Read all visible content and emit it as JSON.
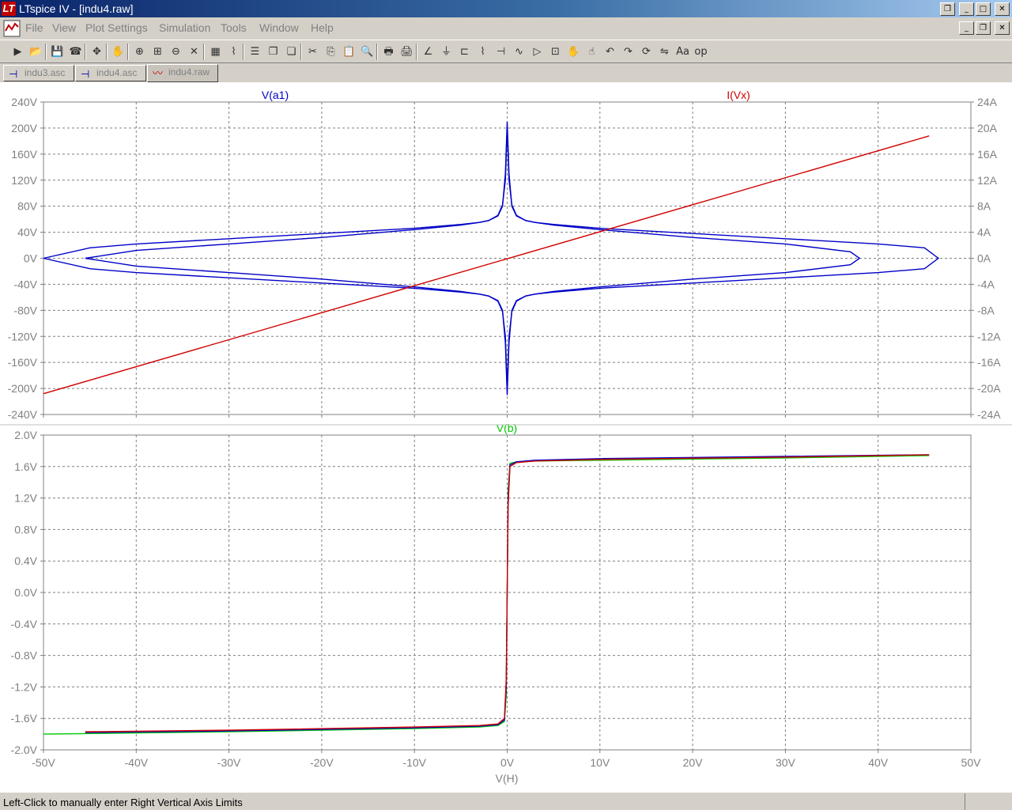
{
  "window": {
    "title": "LTspice IV - [indu4.raw]"
  },
  "menu": [
    "File",
    "View",
    "Plot Settings",
    "Simulation",
    "Tools",
    "Window",
    "Help"
  ],
  "toolbar_icons": [
    "run-icon",
    "open-icon",
    "save-icon",
    "control-panel-icon",
    "autorange-icon",
    "pan-icon",
    "zoom-in-icon",
    "zoom-area-icon",
    "zoom-out-icon",
    "cancel-icon",
    "grid-icon",
    "marker-icon",
    "tile-horizontal-icon",
    "cascade-icon",
    "tile-vertical-icon",
    "cut-icon",
    "copy-icon",
    "paste-icon",
    "find-icon",
    "print-icon",
    "print-setup-icon",
    "wire-icon",
    "ground-icon",
    "label-icon",
    "resistor-icon",
    "capacitor-icon",
    "inductor-icon",
    "diode-icon",
    "component-icon",
    "move-icon",
    "drag-icon",
    "undo-icon",
    "redo-icon",
    "rotate-icon",
    "mirror-icon",
    "text-icon",
    "spice-directive-icon"
  ],
  "tabs": [
    {
      "label": "indu3.asc",
      "icon": "schematic-icon",
      "active": false
    },
    {
      "label": "indu4.asc",
      "icon": "schematic-icon",
      "active": false
    },
    {
      "label": "indu4.raw",
      "icon": "waveform-icon",
      "active": true
    }
  ],
  "status": {
    "message": "Left-Click to manually enter Right Vertical Axis Limits"
  },
  "colors": {
    "va1": "#0000c8",
    "ivx": "#d00000",
    "vb": "#00c800",
    "axis_text": "#808080",
    "grid": "#808080"
  },
  "chart_data": [
    {
      "type": "line",
      "title": "",
      "xlabel": "",
      "x_ticks": [
        "-50V",
        "-40V",
        "-30V",
        "-20V",
        "-10V",
        "0V",
        "10V",
        "20V",
        "30V",
        "40V",
        "50V"
      ],
      "xlim": [
        -50,
        50
      ],
      "ylabel_left": "V(a1)",
      "ylabel_right": "I(Vx)",
      "left_ticks": [
        "240V",
        "200V",
        "160V",
        "120V",
        "80V",
        "40V",
        "0V",
        "-40V",
        "-80V",
        "-120V",
        "-160V",
        "-200V",
        "-240V"
      ],
      "right_ticks": [
        "24A",
        "20A",
        "16A",
        "12A",
        "8A",
        "4A",
        "0A",
        "-4A",
        "-8A",
        "-12A",
        "-16A",
        "-20A",
        "-24A"
      ],
      "ylim_left": [
        -240,
        240
      ],
      "ylim_right": [
        -24,
        24
      ],
      "grid": true,
      "series": [
        {
          "name": "V(a1)",
          "axis": "left",
          "color": "#0000c8",
          "x": [
            -50,
            -45,
            -40,
            -30,
            -20,
            -10,
            -5,
            -3,
            -2,
            -1,
            -0.5,
            -0.2,
            0,
            0.2,
            0.5,
            1,
            2,
            3,
            5,
            10,
            20,
            30,
            40,
            45,
            46.5,
            45,
            40,
            30,
            20,
            10,
            5,
            3,
            2,
            1,
            0.5,
            0.2,
            0,
            -0.2,
            -0.5,
            -1,
            -2,
            -3,
            -5,
            -10,
            -20,
            -30,
            -40,
            -45,
            -50
          ],
          "y": [
            0,
            -16,
            -22,
            -30,
            -38,
            -46,
            -52,
            -55,
            -58,
            -65,
            -80,
            -130,
            -210,
            -130,
            -80,
            -65,
            -58,
            -55,
            -52,
            -46,
            -38,
            -30,
            -22,
            -16,
            0,
            16,
            22,
            30,
            38,
            46,
            52,
            55,
            58,
            65,
            80,
            130,
            210,
            130,
            80,
            65,
            58,
            55,
            52,
            46,
            38,
            30,
            22,
            16,
            0
          ]
        },
        {
          "name": "V(a1)",
          "axis": "left",
          "color": "#0000c8",
          "x": [
            -45.5,
            -40,
            -30,
            -20,
            -10,
            -5,
            -3,
            -2,
            -1,
            -0.5,
            -0.2,
            0,
            0.2,
            0.5,
            1,
            2,
            3,
            5,
            10,
            20,
            30,
            37,
            38,
            37,
            30,
            20,
            10,
            5,
            3,
            2,
            1,
            0.5,
            0.2,
            0,
            -0.2,
            -0.5,
            -1,
            -2,
            -3,
            -5,
            -10,
            -20,
            -30,
            -40,
            -45.5
          ],
          "y": [
            0,
            -12,
            -22,
            -32,
            -44,
            -51,
            -55,
            -58,
            -66,
            -82,
            -120,
            -200,
            -120,
            -82,
            -66,
            -58,
            -55,
            -51,
            -44,
            -32,
            -22,
            -10,
            0,
            10,
            22,
            32,
            44,
            51,
            55,
            58,
            66,
            82,
            120,
            200,
            120,
            82,
            66,
            58,
            55,
            51,
            44,
            32,
            22,
            12,
            0
          ]
        },
        {
          "name": "I(Vx)",
          "axis": "right",
          "color": "#d00000",
          "x": [
            -50,
            45.5
          ],
          "y": [
            -20.8,
            18.8
          ]
        }
      ]
    },
    {
      "type": "line",
      "title": "",
      "xlabel": "V(H)",
      "x_ticks": [
        "-50V",
        "-40V",
        "-30V",
        "-20V",
        "-10V",
        "0V",
        "10V",
        "20V",
        "30V",
        "40V",
        "50V"
      ],
      "xlim": [
        -50,
        50
      ],
      "ylabel_left": "V(b)",
      "left_ticks": [
        "2.0V",
        "1.6V",
        "1.2V",
        "0.8V",
        "0.4V",
        "0.0V",
        "-0.4V",
        "-0.8V",
        "-1.2V",
        "-1.6V",
        "-2.0V"
      ],
      "ylim_left": [
        -2.0,
        2.0
      ],
      "grid": true,
      "series": [
        {
          "name": "V(b)",
          "color": "#00c800",
          "x": [
            -50,
            -30,
            -10,
            -3,
            -1,
            -0.3,
            -0.1,
            0,
            0.1,
            0.3,
            1,
            3,
            10,
            30,
            45.5
          ],
          "y": [
            -1.8,
            -1.77,
            -1.73,
            -1.71,
            -1.69,
            -1.64,
            -1.3,
            0,
            1.3,
            1.64,
            1.66,
            1.67,
            1.68,
            1.71,
            1.74
          ]
        },
        {
          "name": "V(b)",
          "color": "#0000c8",
          "x": [
            -45.5,
            -30,
            -10,
            -3,
            -1,
            -0.3,
            -0.1,
            0,
            0.1,
            0.3,
            1,
            3,
            10,
            30,
            45.5
          ],
          "y": [
            -1.78,
            -1.76,
            -1.72,
            -1.7,
            -1.68,
            -1.62,
            -1.2,
            0,
            1.2,
            1.62,
            1.66,
            1.68,
            1.7,
            1.73,
            1.75
          ]
        },
        {
          "name": "V(b)",
          "color": "#d00000",
          "x": [
            -45.5,
            -30,
            -10,
            -3,
            -1,
            -0.3,
            -0.1,
            0,
            0.1,
            0.3,
            1,
            3,
            10,
            30,
            45.5
          ],
          "y": [
            -1.77,
            -1.75,
            -1.71,
            -1.69,
            -1.67,
            -1.6,
            -1.1,
            0,
            1.1,
            1.6,
            1.65,
            1.67,
            1.69,
            1.72,
            1.75
          ]
        }
      ]
    }
  ]
}
